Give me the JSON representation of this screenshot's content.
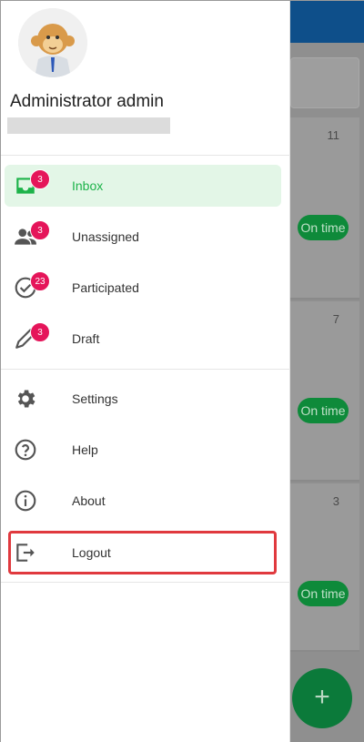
{
  "user": {
    "name": "Administrator admin",
    "email": ""
  },
  "nav": [
    {
      "label": "Inbox",
      "badge": "3",
      "icon": "inbox-icon",
      "active": true
    },
    {
      "label": "Unassigned",
      "badge": "3",
      "icon": "people-icon"
    },
    {
      "label": "Participated",
      "badge": "23",
      "icon": "check-circle-icon"
    },
    {
      "label": "Draft",
      "badge": "3",
      "icon": "pencil-icon"
    }
  ],
  "secondary": [
    {
      "label": "Settings",
      "icon": "gear-icon"
    },
    {
      "label": "Help",
      "icon": "help-circle-icon"
    },
    {
      "label": "About",
      "icon": "info-icon"
    },
    {
      "label": "Logout",
      "icon": "logout-icon"
    }
  ],
  "background": {
    "cards": [
      {
        "count": "11",
        "status": "On time"
      },
      {
        "count": "7",
        "status": "On time"
      },
      {
        "count": "3",
        "status": "On time"
      }
    ],
    "fab_label": "+"
  },
  "colors": {
    "accent": "#1db34a",
    "active_bg": "#e3f6e7",
    "badge": "#e5155a",
    "highlight": "#e0393e",
    "topbar": "#0e4f8a"
  }
}
